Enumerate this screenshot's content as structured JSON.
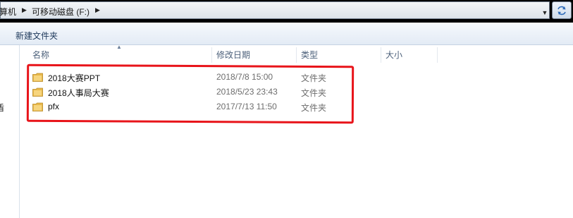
{
  "address": {
    "crumbs": [
      "算机",
      "可移动磁盘 (F:)"
    ],
    "dropdown_icon": "chevron-down-icon",
    "refresh_icon": "refresh-icon"
  },
  "toolbar": {
    "new_folder_label": "新建文件夹"
  },
  "nav": {
    "fragment": "盾"
  },
  "columns": {
    "name": "名称",
    "date": "修改日期",
    "type": "类型",
    "size": "大小"
  },
  "files": [
    {
      "name": "2018大赛PPT",
      "modified": "2018/7/8 15:00",
      "type": "文件夹"
    },
    {
      "name": "2018人事局大赛",
      "modified": "2018/5/23 23:43",
      "type": "文件夹"
    },
    {
      "name": "pfx",
      "modified": "2017/7/13 11:50",
      "type": "文件夹"
    }
  ],
  "colors": {
    "highlight": "#e8141a",
    "folder": "#e8b84a",
    "header_text": "#4c607a"
  }
}
